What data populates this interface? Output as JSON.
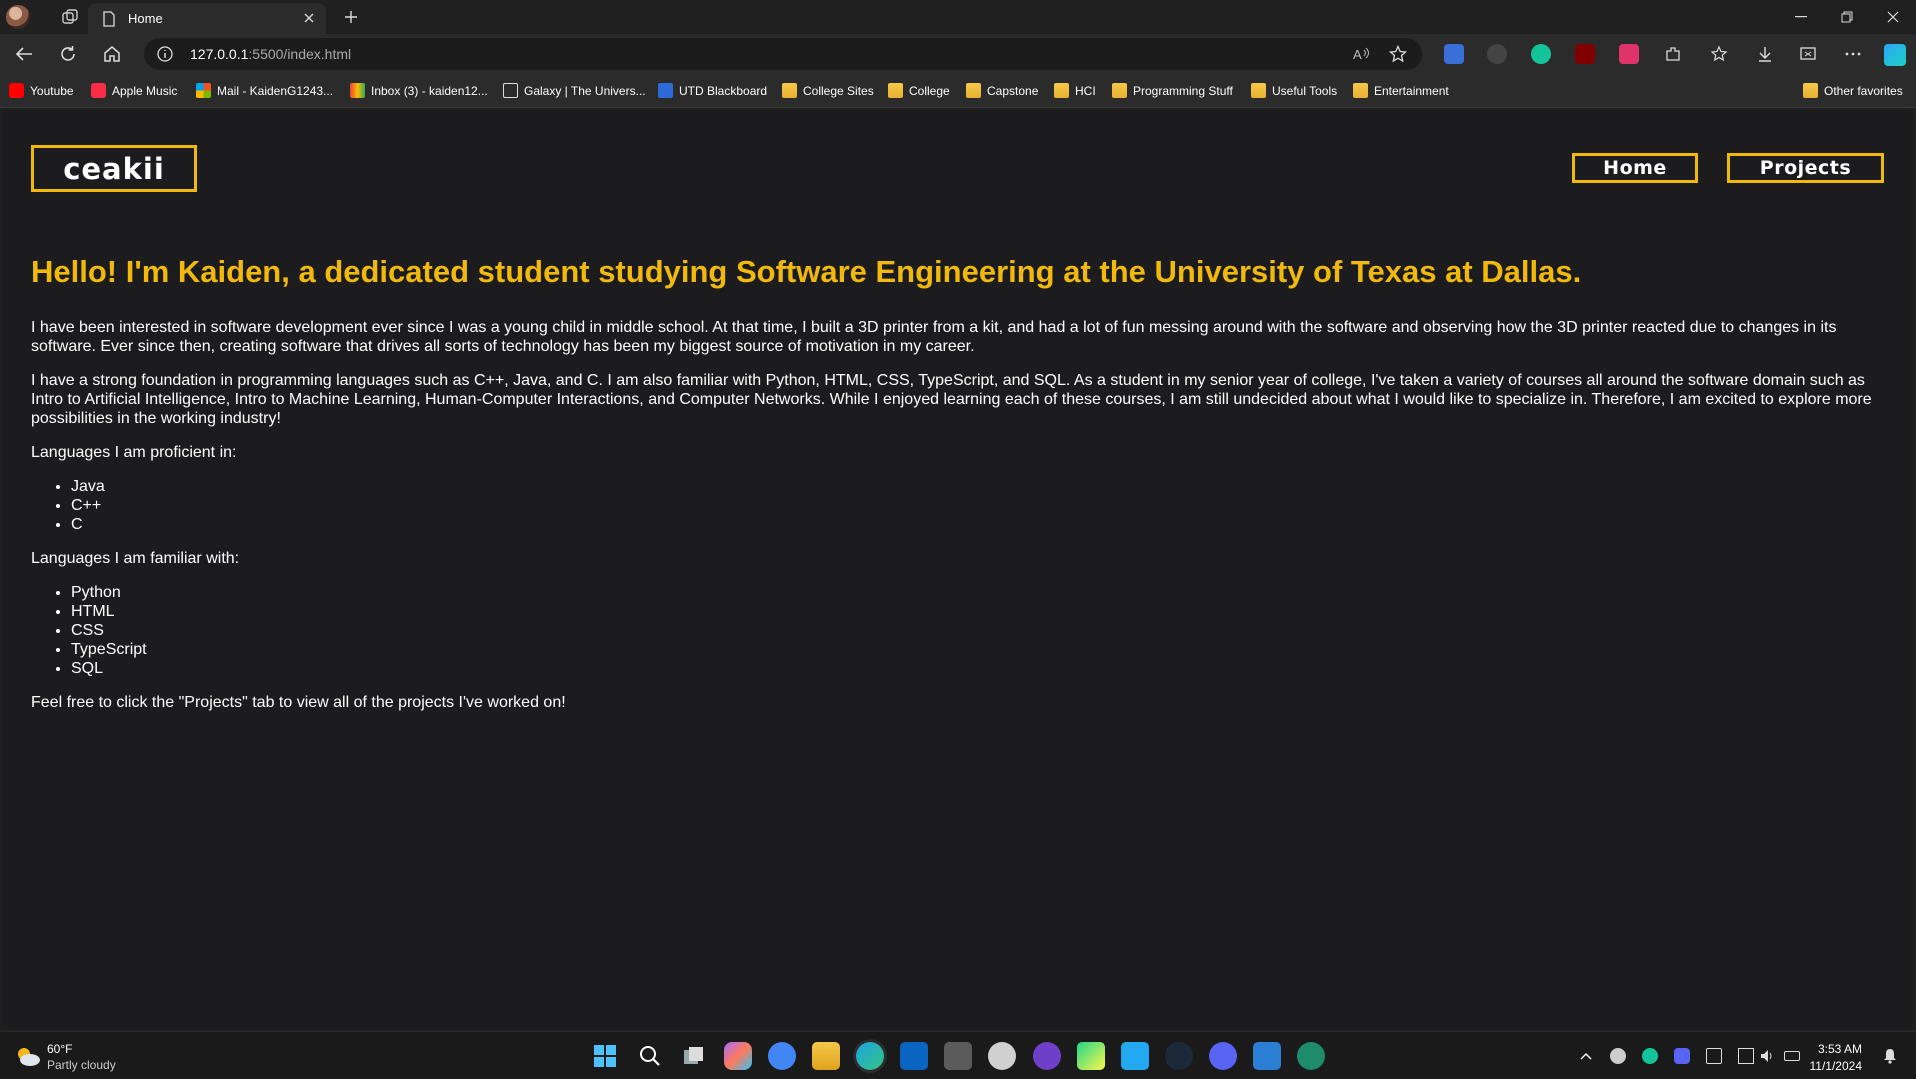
{
  "browser": {
    "tab_title": "Home",
    "url_host": "127.0.0.1",
    "url_rest": ":5500/index.html"
  },
  "favorites": [
    {
      "label": "Youtube",
      "icon": "youtube-icon"
    },
    {
      "label": "Apple Music",
      "icon": "apple-music-icon"
    },
    {
      "label": "Mail - KaidenG1243...",
      "icon": "mail-icon"
    },
    {
      "label": "Inbox (3) - kaiden12...",
      "icon": "gmail-icon"
    },
    {
      "label": "Galaxy | The Univers...",
      "icon": "galaxy-icon"
    },
    {
      "label": "UTD Blackboard",
      "icon": "blackboard-icon"
    },
    {
      "label": "College Sites",
      "icon": "folder-icon"
    },
    {
      "label": "College",
      "icon": "folder-icon"
    },
    {
      "label": "Capstone",
      "icon": "folder-icon"
    },
    {
      "label": "HCI",
      "icon": "folder-icon"
    },
    {
      "label": "Programming Stuff",
      "icon": "folder-icon"
    },
    {
      "label": "Useful Tools",
      "icon": "folder-icon"
    },
    {
      "label": "Entertainment",
      "icon": "folder-icon"
    }
  ],
  "other_favorites": "Other favorites",
  "page": {
    "logo": "ceakii",
    "nav": {
      "home": "Home",
      "projects": "Projects"
    },
    "headline": "Hello! I'm Kaiden, a dedicated student studying Software Engineering at the University of Texas at Dallas.",
    "para1": "I have been interested in software development ever since I was a young child in middle school. At that time, I built a 3D printer from a kit, and had a lot of fun messing around with the software and observing how the 3D printer reacted due to changes in its software. Ever since then, creating software that drives all sorts of technology has been my biggest source of motivation in my career.",
    "para2": "I have a strong foundation in programming languages such as C++, Java, and C. I am also familiar with Python, HTML, CSS, TypeScript, and SQL. As a student in my senior year of college, I've taken a variety of courses all around the software domain such as Intro to Artificial Intelligence, Intro to Machine Learning, Human-Computer Interactions, and Computer Networks. While I enjoyed learning each of these courses, I am still undecided about what I would like to specialize in. Therefore, I am excited to explore more possibilities in the working industry!",
    "proficient_heading": "Languages I am proficient in:",
    "proficient": [
      "Java",
      "C++",
      "C"
    ],
    "familiar_heading": "Languages I am familiar with:",
    "familiar": [
      "Python",
      "HTML",
      "CSS",
      "TypeScript",
      "SQL"
    ],
    "closing": "Feel free to click the \"Projects\" tab to view all of the projects I've worked on!"
  },
  "taskbar": {
    "weather_temp": "60°F",
    "weather_desc": "Partly cloudy",
    "time": "3:53 AM",
    "date": "11/1/2024"
  },
  "colors": {
    "accent": "#f0b90b",
    "page_bg": "#1c1c1e"
  }
}
